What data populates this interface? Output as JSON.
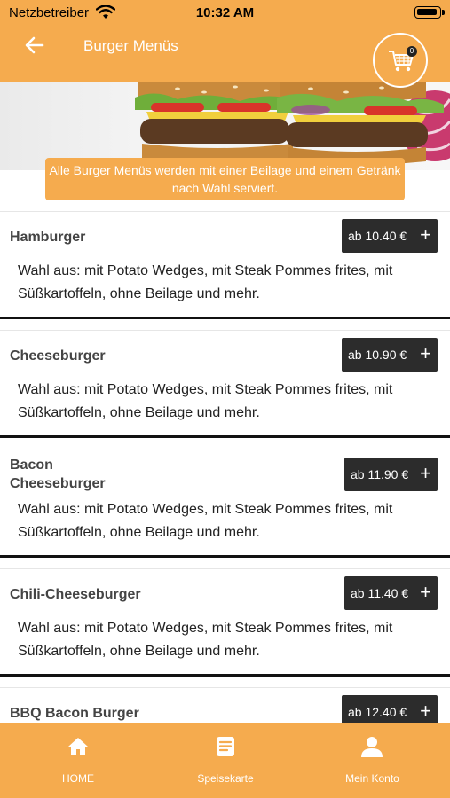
{
  "status_bar": {
    "carrier": "Netzbetreiber",
    "time": "10:32 AM"
  },
  "header": {
    "title": "Burger Menüs",
    "cart_count": "0"
  },
  "hero": {
    "note": "Alle Burger Menüs werden mit einer Beilage und einem Getränk nach Wahl serviert."
  },
  "menu_items": [
    {
      "name": "Hamburger",
      "price": "ab 10.40 €",
      "description": "Wahl aus: mit Potato Wedges, mit Steak Pommes frites, mit Süßkartoffeln, ohne Beilage und mehr."
    },
    {
      "name": "Cheeseburger",
      "price": "ab 10.90 €",
      "description": "Wahl aus: mit Potato Wedges, mit Steak Pommes frites, mit Süßkartoffeln, ohne Beilage und mehr."
    },
    {
      "name_line1": "Bacon",
      "name_line2": "Cheeseburger",
      "price": "ab 11.90 €",
      "description": "Wahl aus: mit Potato Wedges, mit Steak Pommes frites, mit Süßkartoffeln, ohne Beilage und mehr."
    },
    {
      "name": "Chili-Cheeseburger",
      "price": "ab 11.40 €",
      "description": "Wahl aus: mit Potato Wedges, mit Steak Pommes frites, mit Süßkartoffeln, ohne Beilage und mehr."
    },
    {
      "name": "BBQ Bacon Burger",
      "price": "ab 12.40 €"
    }
  ],
  "tabs": [
    {
      "label": "HOME",
      "icon": "home-icon"
    },
    {
      "label": "Speisekarte",
      "icon": "menu-list-icon"
    },
    {
      "label": "Mein Konto",
      "icon": "person-icon"
    }
  ],
  "colors": {
    "accent": "#f5ab4e",
    "price_button": "#2c2c2c"
  }
}
